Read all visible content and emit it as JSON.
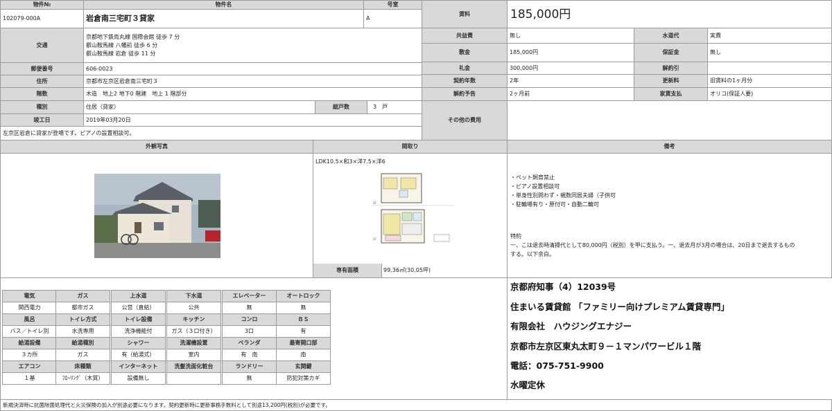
{
  "property": {
    "number_label": "物件№",
    "number": "102079-000A",
    "name_label": "物件名",
    "name": "岩倉南三宅町３貸家",
    "room_label": "号室",
    "room": "A",
    "access_label": "交通",
    "access": [
      "京都地下鉄烏丸線 国際会館 徒歩 7 分",
      "叡山鞍馬線 八幡前 徒歩 6 分",
      "叡山鞍馬線 岩倉 徒歩 11 分"
    ],
    "zip_label": "郵便番号",
    "zip": "606-0023",
    "address_label": "住所",
    "address": "京都市左京区岩倉南三宅町３",
    "floors_label": "階数",
    "floors": "木造　地上2 地下0 階建　地上 1 階部分",
    "type_label": "種別",
    "type": "住居（貸家）",
    "units_label": "総戸数",
    "units": "3　戸",
    "built_label": "竣工日",
    "built": "2019年03月20日",
    "note": "左京区岩倉に貸家が登場です。ピアノの設置相談可。"
  },
  "fees": {
    "rent_label": "賃料",
    "rent": "185,000円",
    "common_label": "共益費",
    "common": "無し",
    "water_label": "水道代",
    "water": "実費",
    "shiki_label": "敷金",
    "shiki": "185,000円",
    "hosho_label": "保証金",
    "hosho": "無し",
    "rei_label": "礼金",
    "rei": "300,000円",
    "kaiyaku_label": "解約引",
    "kaiyaku": "",
    "term_label": "契約年数",
    "term": "2年",
    "renewal_label": "更新料",
    "renewal": "旧賃料の1ヶ月分",
    "notice_label": "解約予告",
    "notice": "2ヶ月前",
    "payment_label": "家賃支払",
    "payment": "オリコ(保証人要)",
    "other_label": "その他の費用",
    "other": ""
  },
  "sections": {
    "photo_label": "外観写真",
    "plan_label": "間取り",
    "remarks_label": "備考"
  },
  "plan": {
    "layout": "LDK10.5×和3×洋7.5×洋6",
    "area_label": "専有面積",
    "area": "99.36㎡(30.05坪)",
    "floor2": "2F",
    "floor1": "1F"
  },
  "remarks": {
    "bullets": [
      "・ペット飼育禁止",
      "・ピアノ設置相談可",
      "・単身性別問わず・親数同居夫婦（子供可",
      "・駐輪場有り・原付可・自動二輪可"
    ],
    "special_label": "特約",
    "special_text": [
      "一、こは退去時清掃代として80,000円（税別）を甲に支払う。一、退去月が3月の場合は、20日まで退去するもの",
      "する。以下余白。"
    ]
  },
  "equipment": {
    "rows": [
      {
        "headers": [
          "電気",
          "ガス",
          "上水道",
          "下水道",
          "エレベーター",
          "オートロック"
        ],
        "values": [
          "関西電力",
          "都市ガス",
          "公営（直結）",
          "公共",
          "無",
          "無"
        ]
      },
      {
        "headers": [
          "風呂",
          "トイレ方式",
          "トイレ設備",
          "キッチン",
          "コンロ",
          "ＢＳ"
        ],
        "values": [
          "バス／トイレ別",
          "水洗専用",
          "洗浄機能付",
          "ガス（３口付き）",
          "3口",
          "有"
        ]
      },
      {
        "headers": [
          "給湯設備",
          "給湯種別",
          "シャワー",
          "洗濯機設置",
          "ベランダ",
          "最寄開口部"
        ],
        "values": [
          "３カ所",
          "ガス",
          "有（給湯式）",
          "室内",
          "有　南",
          "南"
        ]
      },
      {
        "headers": [
          "エアコン",
          "床種類",
          "インターネット",
          "洗髪洗面化粧台",
          "ランドリー",
          "玄関鍵"
        ],
        "values": [
          "１基",
          "ﾌﾛｰﾘﾝｸﾞ（木質）",
          "設備無し",
          "",
          "無",
          "防犯対策カギ"
        ]
      }
    ]
  },
  "agency": {
    "license": "京都府知事（4）12039号",
    "catch": "住まいる賃貸館 「ファミリー向けプレミアム賃貸専門」",
    "company": "有限会社　ハウジングエナジー",
    "address": "京都市左京区東丸太町９－１マンパワービル１階",
    "phone": "電話：075-751-9900",
    "holiday": "水曜定休"
  },
  "footer": "新規決済時に抗菌除菌処理代と火災保険の加入が別途必要になります。契約更新時に更新事務手数料として別途13,200円(税別)が必要です。"
}
